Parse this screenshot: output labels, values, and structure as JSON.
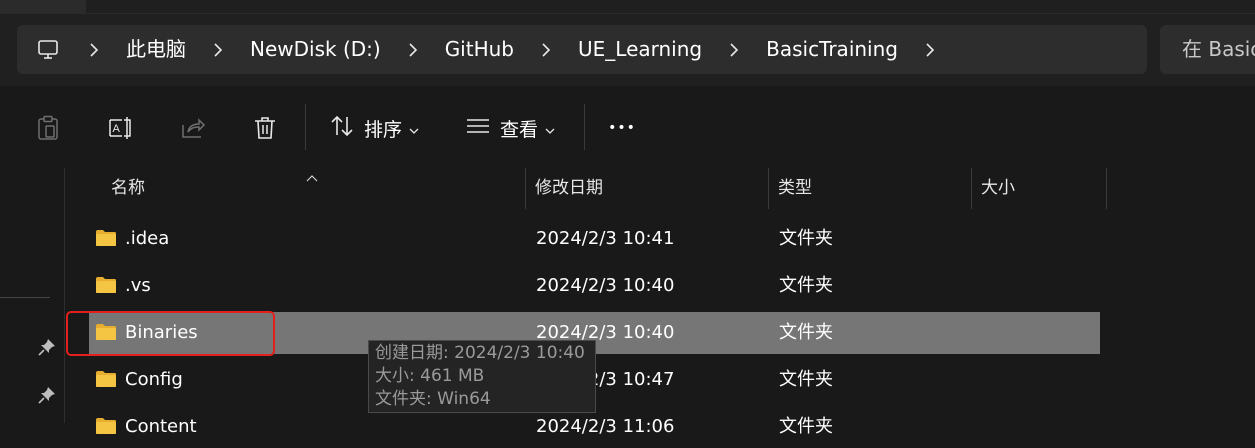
{
  "window": {
    "title": "BasicTraining"
  },
  "address_bar": {
    "breadcrumbs": [
      "此电脑",
      "NewDisk (D:)",
      "GitHub",
      "UE_Learning",
      "BasicTraining"
    ],
    "search_placeholder": "在 BasicTraining 中搜索"
  },
  "toolbar": {
    "sort_label": "排序",
    "view_label": "查看",
    "more_label": "•••"
  },
  "columns": {
    "name": "名称",
    "date_modified": "修改日期",
    "type": "类型",
    "size": "大小"
  },
  "files": [
    {
      "name": ".idea",
      "date": "2024/2/3 10:41",
      "type": "文件夹",
      "size": "",
      "selected": false
    },
    {
      "name": ".vs",
      "date": "2024/2/3 10:40",
      "type": "文件夹",
      "size": "",
      "selected": false
    },
    {
      "name": "Binaries",
      "date": "2024/2/3 10:40",
      "type": "文件夹",
      "size": "",
      "selected": true
    },
    {
      "name": "Config",
      "date": "2024/2/3 10:47",
      "type": "文件夹",
      "size": "",
      "selected": false
    },
    {
      "name": "Content",
      "date": "2024/2/3 11:06",
      "type": "文件夹",
      "size": "",
      "selected": false
    }
  ],
  "tooltip": {
    "created": "创建日期: 2024/2/3 10:40",
    "size": "大小: 461 MB",
    "folder": "文件夹: Win64"
  },
  "colors": {
    "background": "#191919",
    "bar": "#2d2d2d",
    "selected_row": "#767676",
    "folder": "#f4c443",
    "highlight_border": "#e3201c"
  }
}
